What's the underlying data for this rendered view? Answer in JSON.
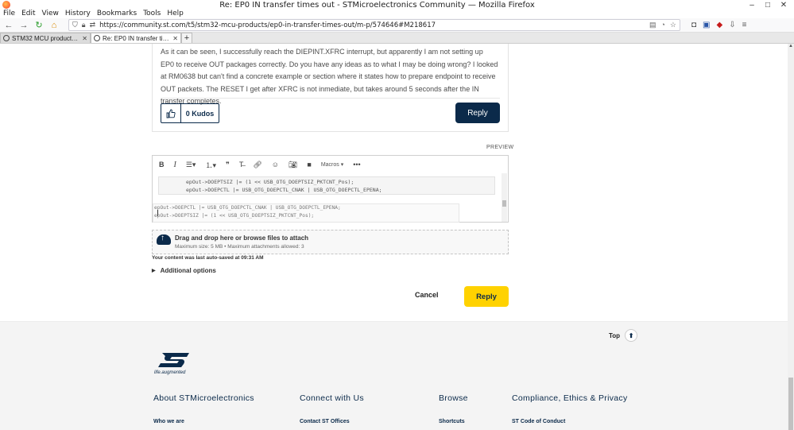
{
  "window": {
    "title": "Re: EP0 IN transfer times out - STMicroelectronics Community — Mozilla Firefox",
    "controls": [
      "–",
      "□",
      "✕"
    ]
  },
  "menu": [
    "File",
    "Edit",
    "View",
    "History",
    "Bookmarks",
    "Tools",
    "Help"
  ],
  "url": "https://community.st.com/t5/stm32-mcu-products/ep0-in-transfer-times-out/m-p/574646#M218617",
  "tabs": [
    {
      "title": "STM32 MCU products - STMicro",
      "active": false
    },
    {
      "title": "Re: EP0 IN transfer times out - ST",
      "active": true
    }
  ],
  "post": {
    "text": "As it can be seen, I successfully reach the DIEPINT.XFRC interrupt, but apparently I am not setting up EP0 to receive OUT packages correctly. Do you have any ideas as to what I may be doing wrong? I looked at RM0638 but can't find a concrete example or section where it states how to prepare endpoint to receive OUT packets. The RESET I get after XFRC is not inmediate, but takes around 5 seconds after the IN transfer completes.",
    "kudos": "0 Kudos",
    "reply_label": "Reply"
  },
  "editor": {
    "preview_label": "PREVIEW",
    "macros_label": "Macros",
    "code_lines": [
      "epOut->DOEPTSIZ |= (1 << USB_OTG_DOEPTSIZ_PKTCNT_Pos);",
      "epOut->DOEPCTL |= USB_OTG_DOEPCTL_CNAK | USB_OTG_DOEPCTL_EPENA;"
    ],
    "overlay_lines": [
      "epOut->DOEPCTL |= USB_OTG_DOEPCTL_CNAK | USB_OTG_DOEPCTL_EPENA;",
      "epOut->DOEPTSIZ |= (1 << USB_OTG_DOEPTSIZ_PKTCNT_Pos);"
    ]
  },
  "attach": {
    "main_pre": "Drag and drop here or ",
    "main_link": "browse",
    "main_post": " files to attach",
    "sub": "Maximum size: 5 MB • Maximum attachments allowed: 3"
  },
  "autosave": "Your content was last auto-saved at 09:31 AM",
  "additional_options": "Additional options",
  "cancel_label": "Cancel",
  "reply_yellow_label": "Reply",
  "footer": {
    "top_label": "Top",
    "tagline": "life.augmented",
    "columns": [
      {
        "heading": "About STMicroelectronics",
        "link": "Who we are"
      },
      {
        "heading": "Connect with Us",
        "link": "Contact ST Offices"
      },
      {
        "heading": "Browse",
        "link": "Shortcuts"
      },
      {
        "heading": "Compliance, Ethics & Privacy",
        "link": "ST Code of Conduct"
      }
    ]
  },
  "colors": {
    "brand_dark": "#0b2a4a",
    "accent_yellow": "#ffd200"
  }
}
